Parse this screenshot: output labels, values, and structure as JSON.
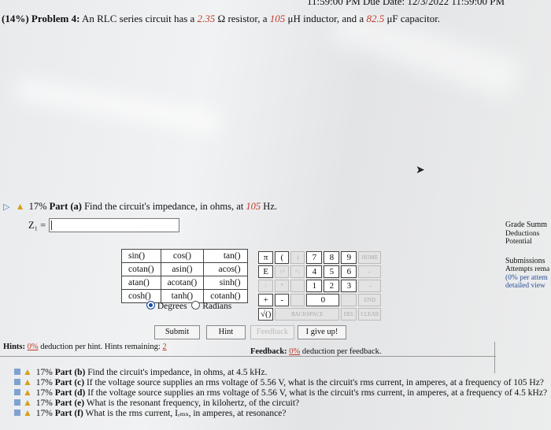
{
  "top_banner": "11:59:00 PM Due Date: 12/3/2022 11:59:00 PM",
  "problem": {
    "weight": "(14%)",
    "label": "Problem 4:",
    "text_1": "An RLC series circuit has a",
    "resistance": "2.35",
    "text_2": "Ω resistor, a",
    "inductance": "105",
    "text_3": "μH inductor, and a",
    "capacitance": "82.5",
    "text_4": "μF capacitor."
  },
  "part_a": {
    "weight": "17%",
    "label": "Part (a)",
    "text": "Find the circuit's impedance, in ohms, at",
    "freq": "105",
    "unit": "Hz.",
    "answer_label": "Z₁ ="
  },
  "functions": [
    [
      "sin()",
      "cos()",
      "tan()"
    ],
    [
      "cotan()",
      "asin()",
      "acos()"
    ],
    [
      "atan()",
      "acotan()",
      "sinh()"
    ],
    [
      "cosh()",
      "tanh()",
      "cotanh()"
    ]
  ],
  "angle_modes": {
    "selected": "Degrees",
    "other": "Radians"
  },
  "keypad": {
    "pi": "π",
    "open": "(",
    "close": ")",
    "seven": "7",
    "eight": "8",
    "nine": "9",
    "home": "HOME",
    "e": "E",
    "up": "↑^",
    "down": "^↓",
    "four": "4",
    "five": "5",
    "six": "6",
    "left": "←",
    "slash": "/",
    "star": "*",
    "one": "1",
    "two": "2",
    "three": "3",
    "right": "→",
    "plus": "+",
    "minus": "-",
    "zero": "0",
    "dot": ".",
    "end": "END",
    "sqrt": "√()",
    "backspace": "BACKSPACE",
    "del": "DEL",
    "clear": "CLEAR"
  },
  "buttons": {
    "submit": "Submit",
    "hint": "Hint",
    "feedback": "Feedback",
    "give_up": "I give up!"
  },
  "hints": {
    "label": "Hints:",
    "deduction": "0%",
    "text": "deduction per hint. Hints remaining:",
    "remaining": "2"
  },
  "feedback_info": {
    "label": "Feedback:",
    "deduction": "0%",
    "text": "deduction per feedback."
  },
  "other_parts": [
    {
      "weight": "17%",
      "label": "Part (b)",
      "text": "Find the circuit's impedance, in ohms, at 4.5 kHz."
    },
    {
      "weight": "17%",
      "label": "Part (c)",
      "text": "If the voltage source supplies an rms voltage of 5.56 V, what is the circuit's rms current, in amperes, at a frequency of 105 Hz?"
    },
    {
      "weight": "17%",
      "label": "Part (d)",
      "text": "If the voltage source supplies an rms voltage of 5.56 V, what is the circuit's rms current, in amperes, at a frequency of 4.5 kHz?"
    },
    {
      "weight": "17%",
      "label": "Part (e)",
      "text": "What is the resonant frequency, in kilohertz, of the circuit?"
    },
    {
      "weight": "17%",
      "label": "Part (f)",
      "text": "What is the rms current, Iᵣₘₛ, in amperes, at resonance?"
    }
  ],
  "sidebar": {
    "grade_summary": "Grade Summ",
    "deductions": "Deductions",
    "potential": "Potential",
    "submissions": "Submissions",
    "attempts": "Attempts rema",
    "per_attempt": "(0% per attem",
    "detailed_view": "detailed view"
  }
}
